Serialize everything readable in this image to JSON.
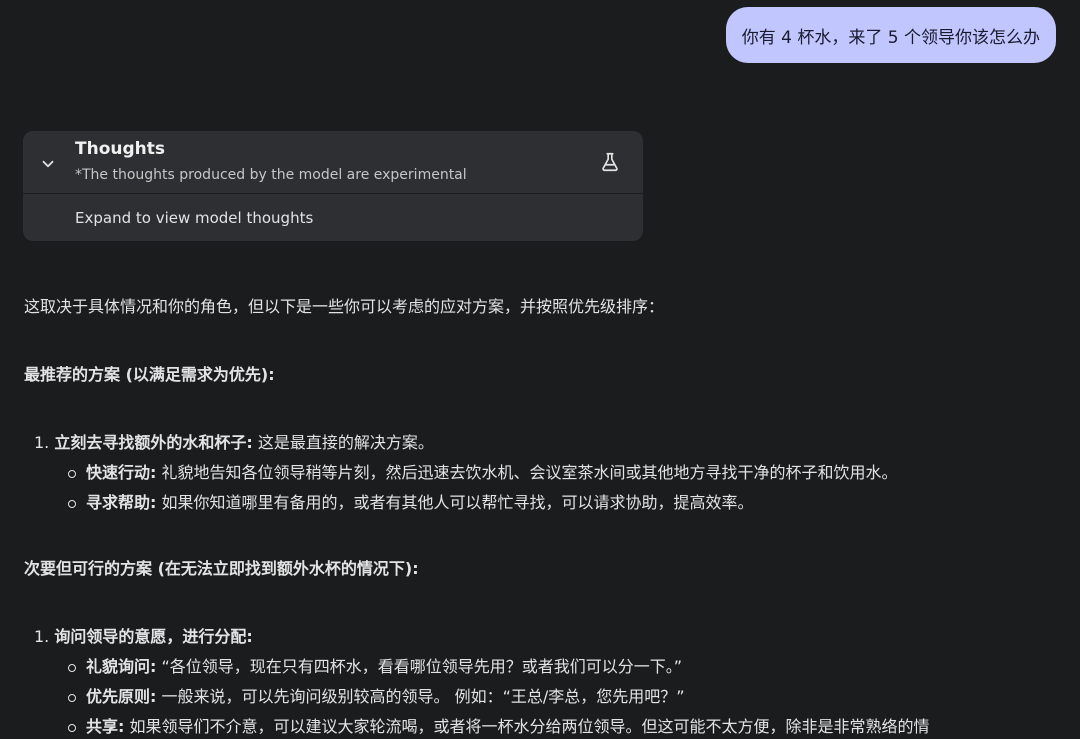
{
  "user_message": "你有 4 杯水，来了 5 个领导你该怎么办",
  "thoughts": {
    "title": "Thoughts",
    "subtitle": "*The thoughts produced by the model are experimental",
    "expand_label": "Expand to view model thoughts",
    "icon_toggle": "chevron-down-icon",
    "icon_badge": "flask-icon"
  },
  "response": {
    "intro": "这取决于具体情况和你的角色，但以下是一些你可以考虑的应对方案，并按照优先级排序：",
    "sections": [
      {
        "heading": "最推荐的方案 (以满足需求为优先):",
        "items": [
          {
            "num": "1.",
            "bold": "立刻去寻找额外的水和杯子:",
            "text": " 这是最直接的解决方案。",
            "subs": [
              {
                "bold": "快速行动:",
                "text": " 礼貌地告知各位领导稍等片刻，然后迅速去饮水机、会议室茶水间或其他地方寻找干净的杯子和饮用水。"
              },
              {
                "bold": "寻求帮助:",
                "text": " 如果你知道哪里有备用的，或者有其他人可以帮忙寻找，可以请求协助，提高效率。"
              }
            ]
          }
        ]
      },
      {
        "heading": "次要但可行的方案 (在无法立即找到额外水杯的情况下):",
        "items": [
          {
            "num": "1.",
            "bold": "询问领导的意愿，进行分配:",
            "text": "",
            "subs": [
              {
                "bold": "礼貌询问:",
                "text": " “各位领导，现在只有四杯水，看看哪位领导先用？或者我们可以分一下。”"
              },
              {
                "bold": "优先原则:",
                "text": " 一般来说，可以先询问级别较高的领导。 例如：“王总/李总，您先用吧？”"
              },
              {
                "bold": "共享:",
                "text": " 如果领导们不介意，可以建议大家轮流喝，或者将一杯水分给两位领导。但这可能不太方便，除非是非常熟络的情"
              }
            ]
          }
        ]
      }
    ]
  }
}
